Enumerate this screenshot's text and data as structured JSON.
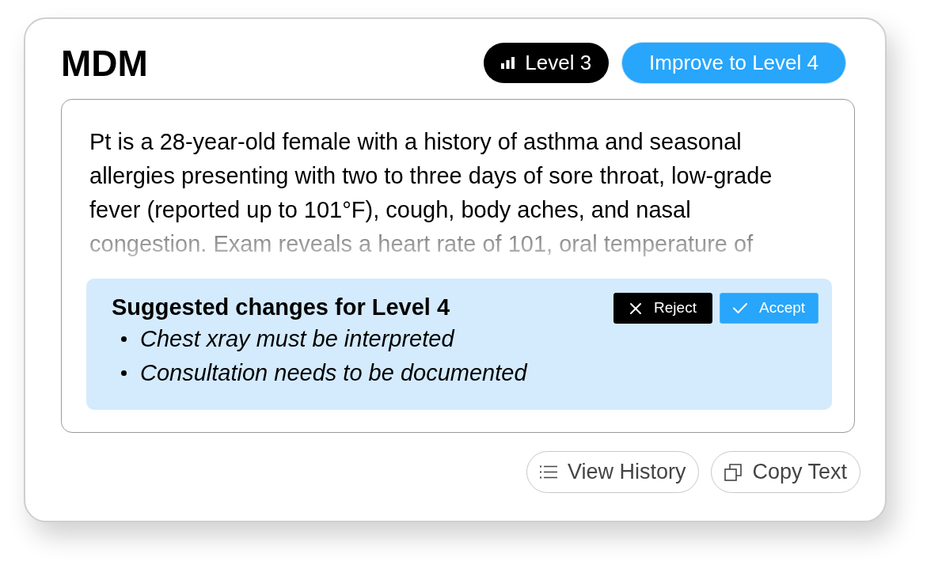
{
  "header": {
    "title": "MDM",
    "level_badge": "Level 3",
    "improve_button": "Improve to Level 4"
  },
  "note": {
    "text": "Pt is a 28-year-old female with a history of asthma and seasonal allergies presenting with two to three days of sore throat, low-grade fever (reported up to 101°F), cough, body aches, and nasal congestion. Exam reveals a heart rate of 101, oral temperature of"
  },
  "suggestions": {
    "title": "Suggested changes for Level 4",
    "items": [
      "Chest xray must be interpreted",
      "Consultation needs to be documented"
    ],
    "buttons": [
      {
        "kind": "reject",
        "label": "Reject"
      },
      {
        "kind": "accept",
        "label": "Accept"
      }
    ]
  },
  "actions": [
    {
      "kind": "history",
      "label": "View History"
    },
    {
      "kind": "copy",
      "label": "Copy Text"
    }
  ]
}
